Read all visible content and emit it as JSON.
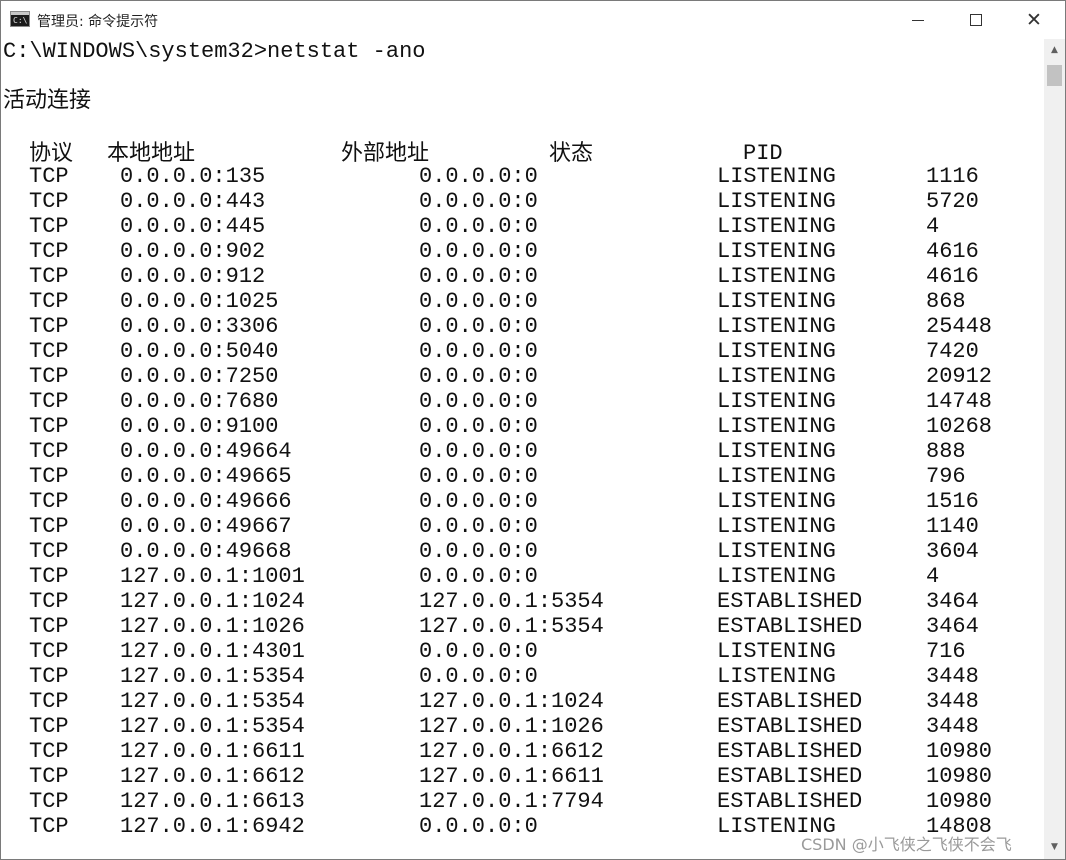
{
  "window": {
    "title": "管理员: 命令提示符",
    "icon_text": "C:\\"
  },
  "console": {
    "command_line": "C:\\WINDOWS\\system32>netstat -ano",
    "section_title": "活动连接",
    "headers": {
      "proto": "协议",
      "local": "本地地址",
      "foreign": "外部地址",
      "state": "状态",
      "pid": "PID"
    },
    "rows": [
      {
        "proto": "TCP",
        "local": "0.0.0.0:135",
        "foreign": "0.0.0.0:0",
        "state": "LISTENING",
        "pid": "1116"
      },
      {
        "proto": "TCP",
        "local": "0.0.0.0:443",
        "foreign": "0.0.0.0:0",
        "state": "LISTENING",
        "pid": "5720"
      },
      {
        "proto": "TCP",
        "local": "0.0.0.0:445",
        "foreign": "0.0.0.0:0",
        "state": "LISTENING",
        "pid": "4"
      },
      {
        "proto": "TCP",
        "local": "0.0.0.0:902",
        "foreign": "0.0.0.0:0",
        "state": "LISTENING",
        "pid": "4616"
      },
      {
        "proto": "TCP",
        "local": "0.0.0.0:912",
        "foreign": "0.0.0.0:0",
        "state": "LISTENING",
        "pid": "4616"
      },
      {
        "proto": "TCP",
        "local": "0.0.0.0:1025",
        "foreign": "0.0.0.0:0",
        "state": "LISTENING",
        "pid": "868"
      },
      {
        "proto": "TCP",
        "local": "0.0.0.0:3306",
        "foreign": "0.0.0.0:0",
        "state": "LISTENING",
        "pid": "25448"
      },
      {
        "proto": "TCP",
        "local": "0.0.0.0:5040",
        "foreign": "0.0.0.0:0",
        "state": "LISTENING",
        "pid": "7420"
      },
      {
        "proto": "TCP",
        "local": "0.0.0.0:7250",
        "foreign": "0.0.0.0:0",
        "state": "LISTENING",
        "pid": "20912"
      },
      {
        "proto": "TCP",
        "local": "0.0.0.0:7680",
        "foreign": "0.0.0.0:0",
        "state": "LISTENING",
        "pid": "14748"
      },
      {
        "proto": "TCP",
        "local": "0.0.0.0:9100",
        "foreign": "0.0.0.0:0",
        "state": "LISTENING",
        "pid": "10268"
      },
      {
        "proto": "TCP",
        "local": "0.0.0.0:49664",
        "foreign": "0.0.0.0:0",
        "state": "LISTENING",
        "pid": "888"
      },
      {
        "proto": "TCP",
        "local": "0.0.0.0:49665",
        "foreign": "0.0.0.0:0",
        "state": "LISTENING",
        "pid": "796"
      },
      {
        "proto": "TCP",
        "local": "0.0.0.0:49666",
        "foreign": "0.0.0.0:0",
        "state": "LISTENING",
        "pid": "1516"
      },
      {
        "proto": "TCP",
        "local": "0.0.0.0:49667",
        "foreign": "0.0.0.0:0",
        "state": "LISTENING",
        "pid": "1140"
      },
      {
        "proto": "TCP",
        "local": "0.0.0.0:49668",
        "foreign": "0.0.0.0:0",
        "state": "LISTENING",
        "pid": "3604"
      },
      {
        "proto": "TCP",
        "local": "127.0.0.1:1001",
        "foreign": "0.0.0.0:0",
        "state": "LISTENING",
        "pid": "4"
      },
      {
        "proto": "TCP",
        "local": "127.0.0.1:1024",
        "foreign": "127.0.0.1:5354",
        "state": "ESTABLISHED",
        "pid": "3464"
      },
      {
        "proto": "TCP",
        "local": "127.0.0.1:1026",
        "foreign": "127.0.0.1:5354",
        "state": "ESTABLISHED",
        "pid": "3464"
      },
      {
        "proto": "TCP",
        "local": "127.0.0.1:4301",
        "foreign": "0.0.0.0:0",
        "state": "LISTENING",
        "pid": "716"
      },
      {
        "proto": "TCP",
        "local": "127.0.0.1:5354",
        "foreign": "0.0.0.0:0",
        "state": "LISTENING",
        "pid": "3448"
      },
      {
        "proto": "TCP",
        "local": "127.0.0.1:5354",
        "foreign": "127.0.0.1:1024",
        "state": "ESTABLISHED",
        "pid": "3448"
      },
      {
        "proto": "TCP",
        "local": "127.0.0.1:5354",
        "foreign": "127.0.0.1:1026",
        "state": "ESTABLISHED",
        "pid": "3448"
      },
      {
        "proto": "TCP",
        "local": "127.0.0.1:6611",
        "foreign": "127.0.0.1:6612",
        "state": "ESTABLISHED",
        "pid": "10980"
      },
      {
        "proto": "TCP",
        "local": "127.0.0.1:6612",
        "foreign": "127.0.0.1:6611",
        "state": "ESTABLISHED",
        "pid": "10980"
      },
      {
        "proto": "TCP",
        "local": "127.0.0.1:6613",
        "foreign": "127.0.0.1:7794",
        "state": "ESTABLISHED",
        "pid": "10980"
      },
      {
        "proto": "TCP",
        "local": "127.0.0.1:6942",
        "foreign": "0.0.0.0:0",
        "state": "LISTENING",
        "pid": "14808"
      }
    ]
  },
  "watermark": "CSDN @小飞侠之飞侠不会飞",
  "icons": {
    "minimize": "minimize-icon",
    "maximize": "maximize-icon",
    "close": "close-icon",
    "scroll_up": "scroll-up-arrow-icon",
    "scroll_down": "scroll-down-arrow-icon"
  },
  "colors": {
    "background": "#ffffff",
    "text": "#111111",
    "scrollbar_track": "#f0f0f0",
    "scrollbar_thumb": "#c2c2c2"
  }
}
